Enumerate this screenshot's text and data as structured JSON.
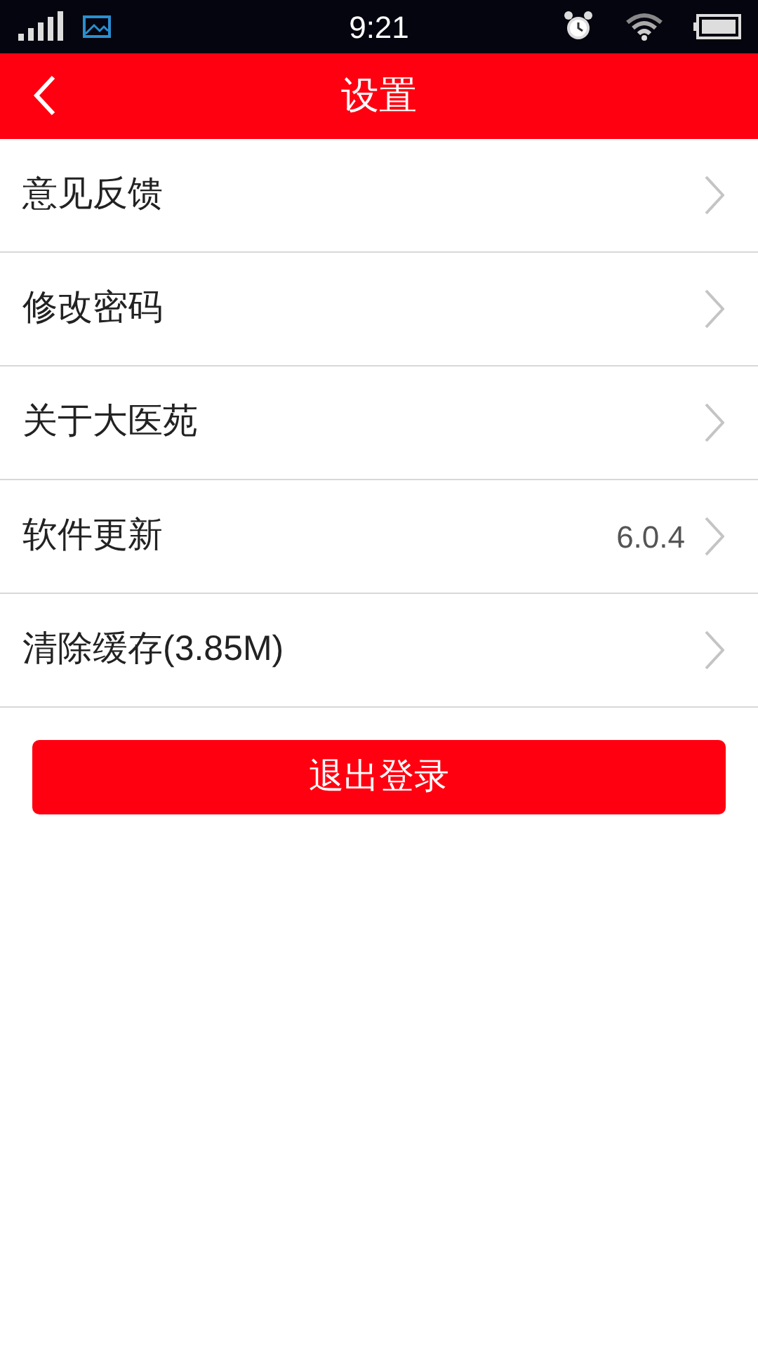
{
  "status_bar": {
    "time": "9:21"
  },
  "header": {
    "title": "设置"
  },
  "settings": [
    {
      "label": "意见反馈"
    },
    {
      "label": "修改密码"
    },
    {
      "label": "关于大医苑"
    },
    {
      "label": "软件更新",
      "value": "6.0.4"
    },
    {
      "label": "清除缓存(3.85M)"
    }
  ],
  "logout_button": {
    "label": "退出登录"
  }
}
